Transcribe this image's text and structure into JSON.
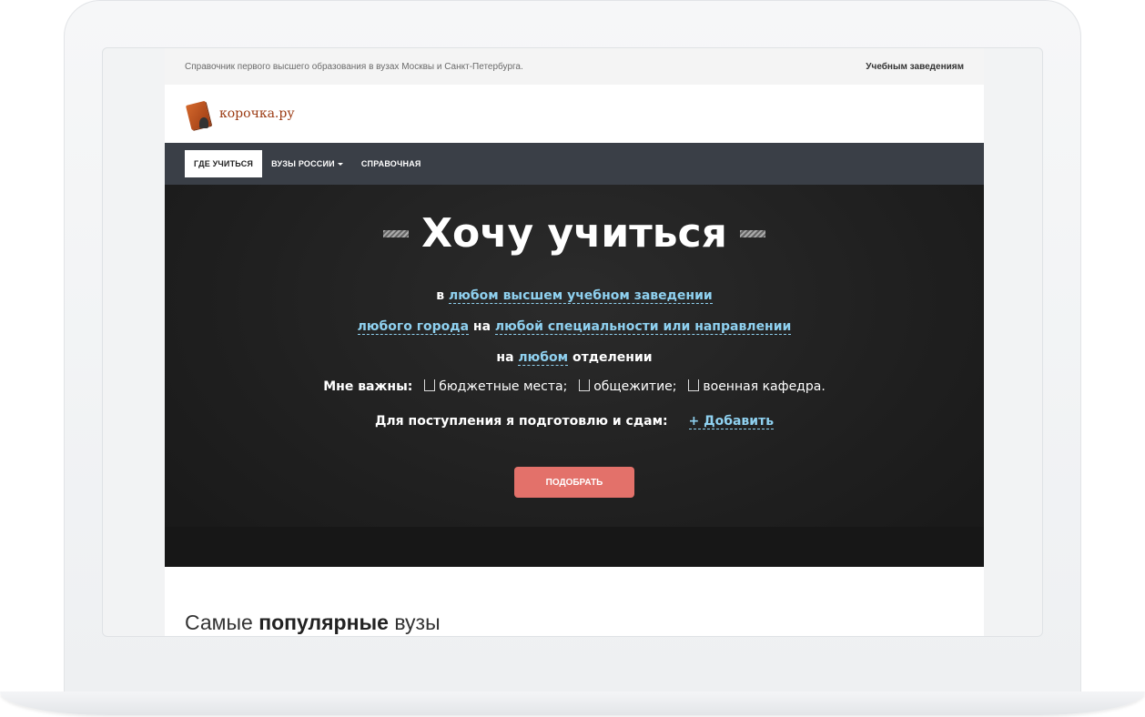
{
  "topbar": {
    "tagline": "Справочник первого высшего образования в вузах Москвы и Санкт-Петербурга.",
    "link": "Учебным заведениям"
  },
  "logo": {
    "text": "корочка.ру"
  },
  "nav": {
    "items": [
      {
        "label": "ГДЕ УЧИТЬСЯ",
        "active": true
      },
      {
        "label": "ВУЗЫ РОССИИ",
        "dropdown": true
      },
      {
        "label": "СПРАВОЧНАЯ"
      }
    ]
  },
  "hero": {
    "title": "Хочу учиться",
    "line1_prefix": "в",
    "line1_link": "любом высшем учебном заведении",
    "line2_link1": "любого города",
    "line2_mid": "на",
    "line2_link2": "любой специальности или направлении",
    "line3_prefix": "на",
    "line3_link": "любом",
    "line3_suffix": "отделении",
    "important_label": "Мне важны:",
    "options": [
      "бюджетные места;",
      "общежитие;",
      "военная кафедра."
    ],
    "exams_label": "Для поступления я подготовлю и сдам:",
    "add_label": "+ Добавить",
    "submit": "ПОДОБРАТЬ"
  },
  "section": {
    "title_light": "Самые",
    "title_bold": "популярные",
    "title_tail": "вузы"
  },
  "colors": {
    "nav_bg": "#3a3f47",
    "button": "#e3716a",
    "link": "#8fd1f0"
  }
}
